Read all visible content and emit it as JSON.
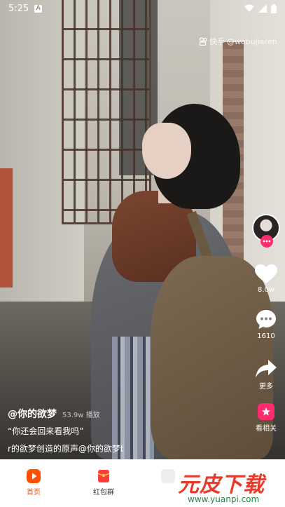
{
  "status_bar": {
    "time": "5:25",
    "notification_icon": "A"
  },
  "watermark": {
    "brand": "快手",
    "handle": "@wobujiaren"
  },
  "right_rail": {
    "like_count": "8.0w",
    "comment_count": "1610",
    "share_label": "更多",
    "related_label": "看相关",
    "accent_color": "#fe2c6e"
  },
  "caption": {
    "author": "@你的欲梦",
    "plays": "53.9w 播放",
    "description": "“你还会回来看我吗”",
    "music": "r的欲梦创造的原声@你的欲梦t"
  },
  "bottom_nav": {
    "items": [
      {
        "label": "首页",
        "active": true
      },
      {
        "label": "红包群",
        "active": false
      },
      {
        "label": "",
        "active": false
      }
    ],
    "active_color": "#ff5000"
  },
  "site_logo": {
    "text": "元皮下载",
    "url": "www.yuanpi.com"
  }
}
